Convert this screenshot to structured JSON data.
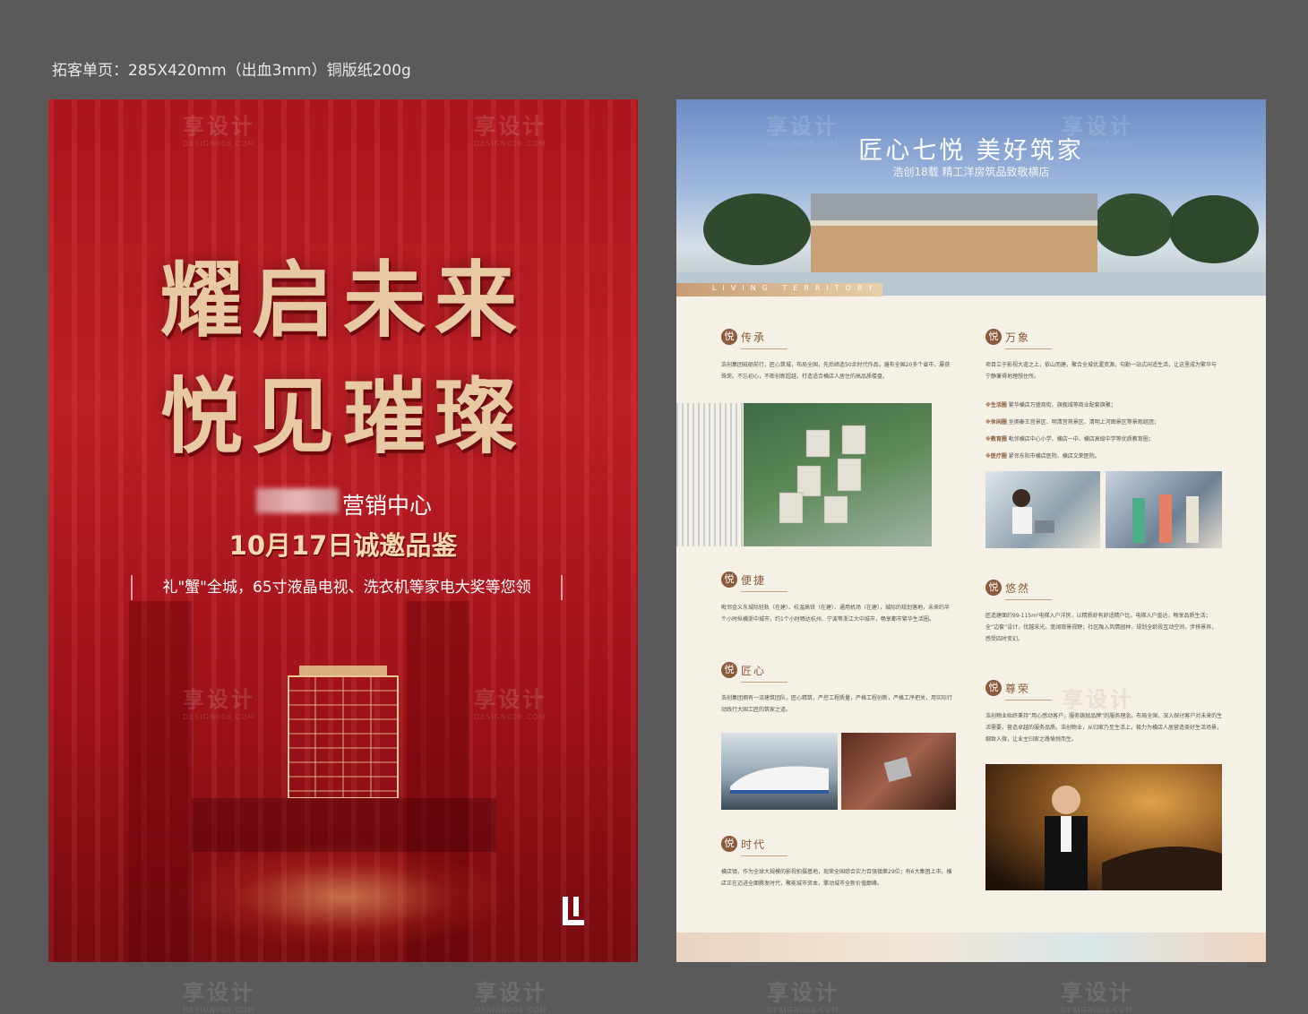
{
  "spec_label": "拓客单页：285X420mm（出血3mm）铜版纸200g",
  "watermark": {
    "cn": "享设计",
    "en": "DESIGN006.COM"
  },
  "left_flyer": {
    "headline_line1": "耀启未来",
    "headline_line2": "悦见璀璨",
    "center_label": "营销中心",
    "date_line": "10月17日诚邀品鉴",
    "gift_line": "礼\"蟹\"全城，65寸液晶电视、洗衣机等家电大奖等您领",
    "colors": {
      "background": "#b2161d",
      "gold": "#e7c9a3"
    }
  },
  "right_flyer": {
    "hero_title": "匠心七悦  美好筑家",
    "hero_subtitle": "浩创18载  精工洋房筑品致敬横店",
    "hero_strip": "LIVING TERRITORY",
    "badge_char": "悦",
    "sections": {
      "chuancheng": {
        "title": "传承",
        "text": "浩创集团砥砺前行，匠心筑城，布局全国，先后缔造50余时代作品，遍布全国20多个省市，屡获殊荣。不忘初心，不断创新超越，打造适合横店人居住的高品质楼盘。"
      },
      "wanxiang": {
        "title": "万象",
        "text": "项目立于影视大道之上，依山而建，聚合全城优渥资源，勾勒一站式闲适生活，让这里成为繁华与宁静兼得地理想住所。",
        "bullets": [
          {
            "k": "※生活圈",
            "v": "繁华横店万盛商街、旗舰城等商业配套旗聚；"
          },
          {
            "k": "※休闲圈",
            "v": "坐拥秦王宫景区、明清宫苑景区、清明上河图景区等景观组团；"
          },
          {
            "k": "※教育圈",
            "v": "毗邻横店中心小学、横店一中、横店高级中学等优质教育圈；"
          },
          {
            "k": "※医疗圈",
            "v": "紧邻东阳市横店医院、横店文荣医院。"
          }
        ]
      },
      "bianjie": {
        "title": "便捷",
        "text": "毗邻金义东城际轻轨（在建）、杭温高铁（在建）、通用机场（在建），城际的规划落地，未来约半个小时纵横浙中城市，约1个小时畅达杭州、宁波等浙江大中城市，畅享都市繁华生活圈。"
      },
      "youran": {
        "title": "悠然",
        "text": "匠造建面约99-115m²电梯入户洋房，以精质舒有舒适精户比，电梯入户直达，畅享品质生活；全“边套”设计，优越采光，宽阔观景视野；社区融入风情园林，规划全龄段互动空间，步移景异，感受四时变幻。"
      },
      "jiangxin": {
        "title": "匠心",
        "text": "浩创集团拥有一流建筑团队，匠心精筑，严控工程质量，严格工程创新，严格工序把关，用实际行动践行大国工匠的筑家之道。"
      },
      "zunrong": {
        "title": "尊荣",
        "text": "浩创物业始终秉持“用心感动客户，服务铸就品牌”的服务理念，布局全国，深入探讨客户对未来的生活需要，营造卓越的服务品质。浩创物业，从归家乃至生活上，极力为横店人居营造美好生活场景，细致入微，让业主归家之路愉悦而生。"
      },
      "shidai": {
        "title": "时代",
        "text": "横店镇，作为全球大规模的影视拍摄基地，现荣全国综合实力百强镇第29位；有6大集团上市。横店正在迈进全面腾发时代，聚能城市资本，擎动城市全新价值巅峰。"
      }
    }
  }
}
